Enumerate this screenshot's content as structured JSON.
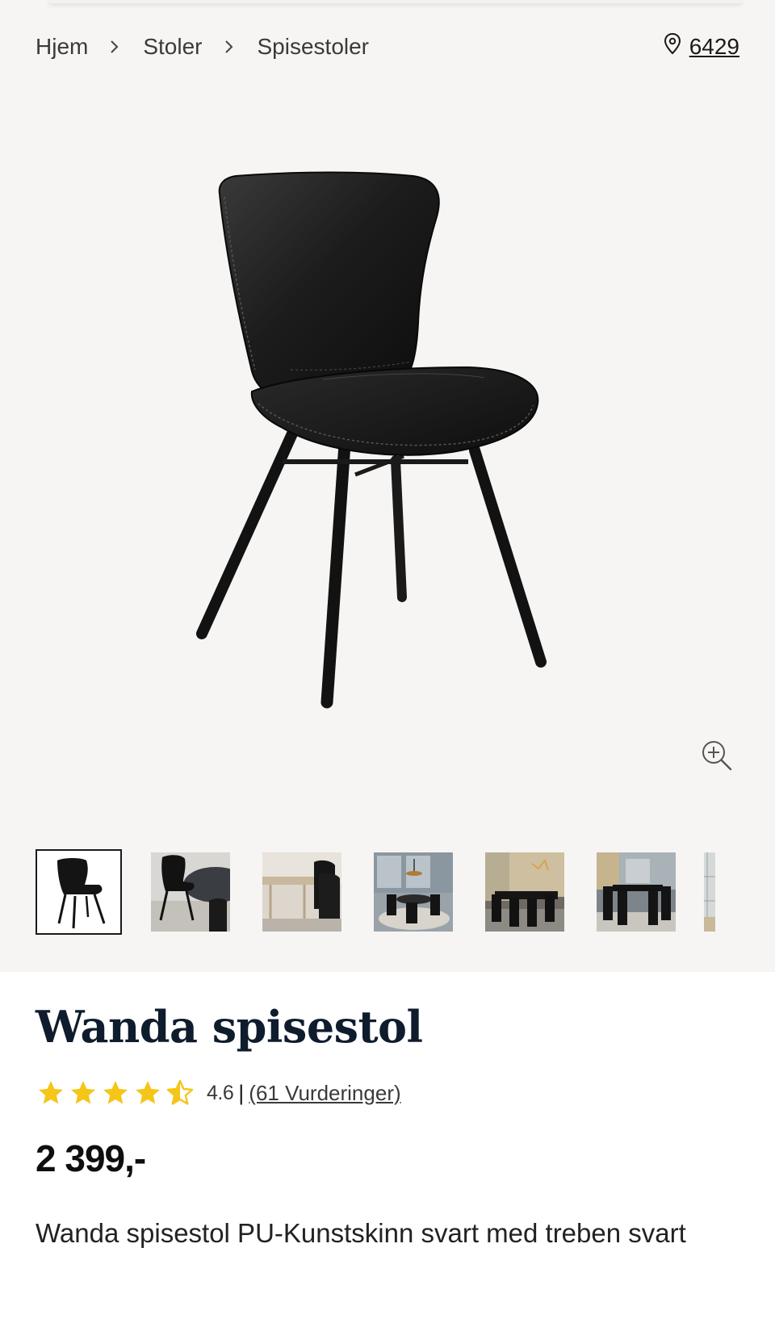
{
  "breadcrumb": {
    "items": [
      {
        "label": "Hjem"
      },
      {
        "label": "Stoler"
      },
      {
        "label": "Spisestoler"
      }
    ]
  },
  "store": {
    "icon": "location-pin-icon",
    "code": "6429"
  },
  "gallery": {
    "zoom_icon": "zoom-in-icon",
    "thumbnails_count": 7,
    "selected_index": 0
  },
  "product": {
    "title": "Wanda spisestol",
    "rating": {
      "value": "4.6",
      "separator": "|",
      "count_label": "(61 Vurderinger)",
      "stars_filled": 4.5,
      "stars_max": 5,
      "star_color": "#f5c518"
    },
    "price": "2 399,-",
    "description": "Wanda spisestol PU-Kunstskinn svart med treben svart"
  }
}
